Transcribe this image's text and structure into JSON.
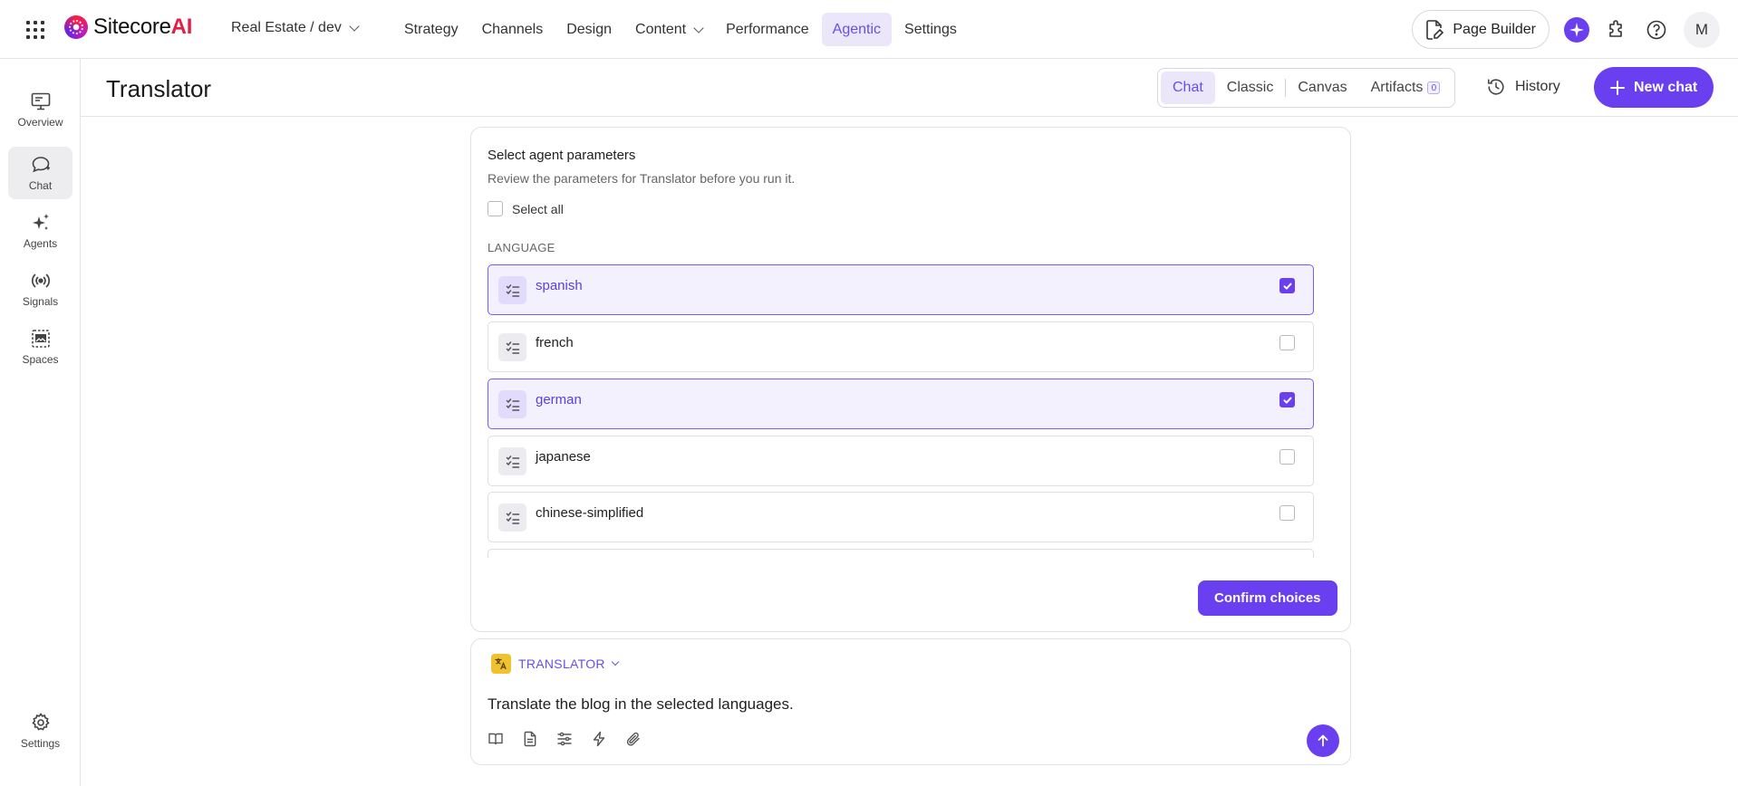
{
  "app": {
    "brand_name": "Sitecore",
    "brand_suffix": "AI",
    "site_selector": "Real Estate / dev"
  },
  "nav": {
    "items": [
      {
        "label": "Strategy"
      },
      {
        "label": "Channels"
      },
      {
        "label": "Design"
      },
      {
        "label": "Content"
      },
      {
        "label": "Performance"
      },
      {
        "label": "Agentic"
      },
      {
        "label": "Settings"
      }
    ],
    "active": "Agentic"
  },
  "top_right": {
    "page_builder": "Page Builder",
    "avatar_initial": "M"
  },
  "rail": {
    "items": [
      {
        "label": "Overview",
        "icon": "monitor-icon"
      },
      {
        "label": "Chat",
        "icon": "chat-bubble-icon"
      },
      {
        "label": "Agents",
        "icon": "sparkles-icon"
      },
      {
        "label": "Signals",
        "icon": "broadcast-icon"
      },
      {
        "label": "Spaces",
        "icon": "image-frame-icon"
      }
    ],
    "active": "Chat",
    "settings_label": "Settings"
  },
  "header": {
    "title": "Translator",
    "view_tabs": [
      {
        "label": "Chat"
      },
      {
        "label": "Classic"
      },
      {
        "label": "Canvas"
      },
      {
        "label": "Artifacts",
        "count": "0"
      }
    ],
    "active_view": "Chat",
    "history_label": "History",
    "new_chat_label": "New chat"
  },
  "parameters": {
    "title": "Select agent parameters",
    "subtitle": "Review the parameters for Translator before you run it.",
    "select_all_label": "Select all",
    "section_label": "LANGUAGE",
    "options": [
      {
        "label": "spanish",
        "checked": true
      },
      {
        "label": "french",
        "checked": false
      },
      {
        "label": "german",
        "checked": true
      },
      {
        "label": "japanese",
        "checked": false
      },
      {
        "label": "chinese-simplified",
        "checked": false
      }
    ],
    "confirm_label": "Confirm choices"
  },
  "composer": {
    "agent_name": "TRANSLATOR",
    "message": "Translate the blog in the selected languages."
  },
  "colors": {
    "accent": "#6a3ff0",
    "accent_soft": "#ece6fb",
    "border": "#e4e4e7"
  }
}
